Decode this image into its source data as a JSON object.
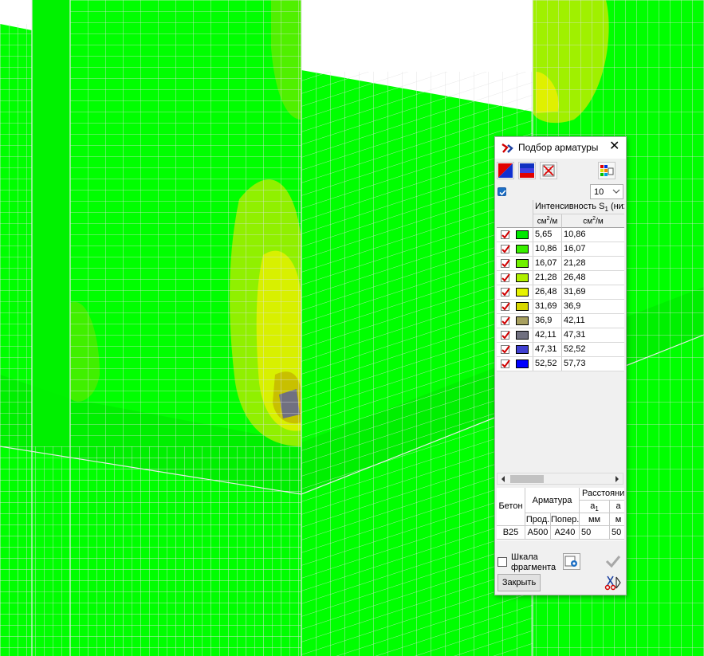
{
  "dialog": {
    "title": "Подбор арматуры",
    "levels_value": "10",
    "column_header": "Интенсивность S",
    "column_header_sub": "1",
    "column_header_tail": " (ниж",
    "unit_base": "см",
    "unit_sup": "2",
    "unit_tail": "/м",
    "close_label": "Закрыть",
    "scale_label_line1": "Шкала",
    "scale_label_line2": "фрагмента"
  },
  "legend": [
    {
      "from": "5,65",
      "to": "10,86",
      "color": "#00e800"
    },
    {
      "from": "10,86",
      "to": "16,07",
      "color": "#38f000"
    },
    {
      "from": "16,07",
      "to": "21,28",
      "color": "#70f000"
    },
    {
      "from": "21,28",
      "to": "26,48",
      "color": "#b0f000"
    },
    {
      "from": "26,48",
      "to": "31,69",
      "color": "#e6f200"
    },
    {
      "from": "31,69",
      "to": "36,9",
      "color": "#d8d800"
    },
    {
      "from": "36,9",
      "to": "42,11",
      "color": "#a8a060"
    },
    {
      "from": "42,11",
      "to": "47,31",
      "color": "#707080"
    },
    {
      "from": "47,31",
      "to": "52,52",
      "color": "#4040d0"
    },
    {
      "from": "52,52",
      "to": "57,73",
      "color": "#0000ff"
    }
  ],
  "params": {
    "concrete_header": "Бетон",
    "rebar_header": "Арматура",
    "distance_header": "Расстояни",
    "a1_label": "a",
    "a1_sub": "1",
    "a2_label": "a",
    "long_label": "Прод.",
    "trans_label": "Попер.",
    "mm_label": "мм",
    "mm2_label": "м",
    "concrete": "B25",
    "rebar_long": "A500",
    "rebar_trans": "A240",
    "a1": "50",
    "a2": "50"
  },
  "colors": {
    "model_base": "#00ff00",
    "mesh_line": "#d9d9d9"
  }
}
